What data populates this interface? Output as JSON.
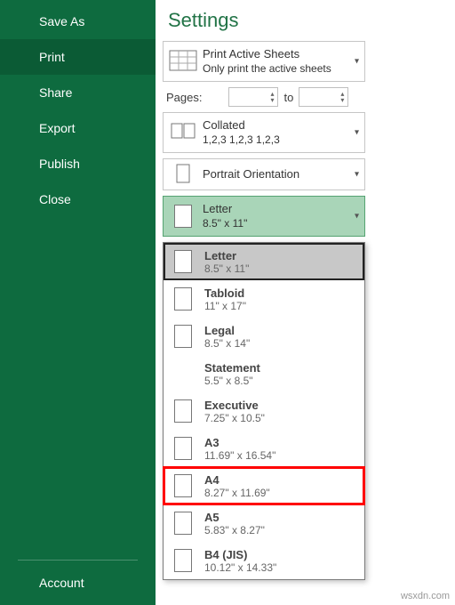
{
  "sidebar": {
    "items": [
      "Save As",
      "Print",
      "Share",
      "Export",
      "Publish",
      "Close"
    ],
    "active_index": 1,
    "account": "Account"
  },
  "settings": {
    "heading": "Settings",
    "print_area": {
      "title": "Print Active Sheets",
      "sub": "Only print the active sheets"
    },
    "pages": {
      "label": "Pages:",
      "to": "to"
    },
    "collated": {
      "title": "Collated",
      "sub": "1,2,3    1,2,3    1,2,3"
    },
    "orientation": {
      "title": "Portrait Orientation"
    },
    "paper": {
      "title": "Letter",
      "sub": "8.5\" x 11\""
    }
  },
  "paper_options": [
    {
      "name": "Letter",
      "dims": "8.5\" x 11\"",
      "selected": true
    },
    {
      "name": "Tabloid",
      "dims": "11\" x 17\""
    },
    {
      "name": "Legal",
      "dims": "8.5\" x 14\""
    },
    {
      "name": "Statement",
      "dims": "5.5\" x 8.5\"",
      "no_icon": true
    },
    {
      "name": "Executive",
      "dims": "7.25\" x 10.5\""
    },
    {
      "name": "A3",
      "dims": "11.69\" x 16.54\""
    },
    {
      "name": "A4",
      "dims": "8.27\" x 11.69\"",
      "highlight": true
    },
    {
      "name": "A5",
      "dims": "5.83\" x 8.27\""
    },
    {
      "name": "B4 (JIS)",
      "dims": "10.12\" x 14.33\""
    }
  ],
  "watermark": "wsxdn.com"
}
